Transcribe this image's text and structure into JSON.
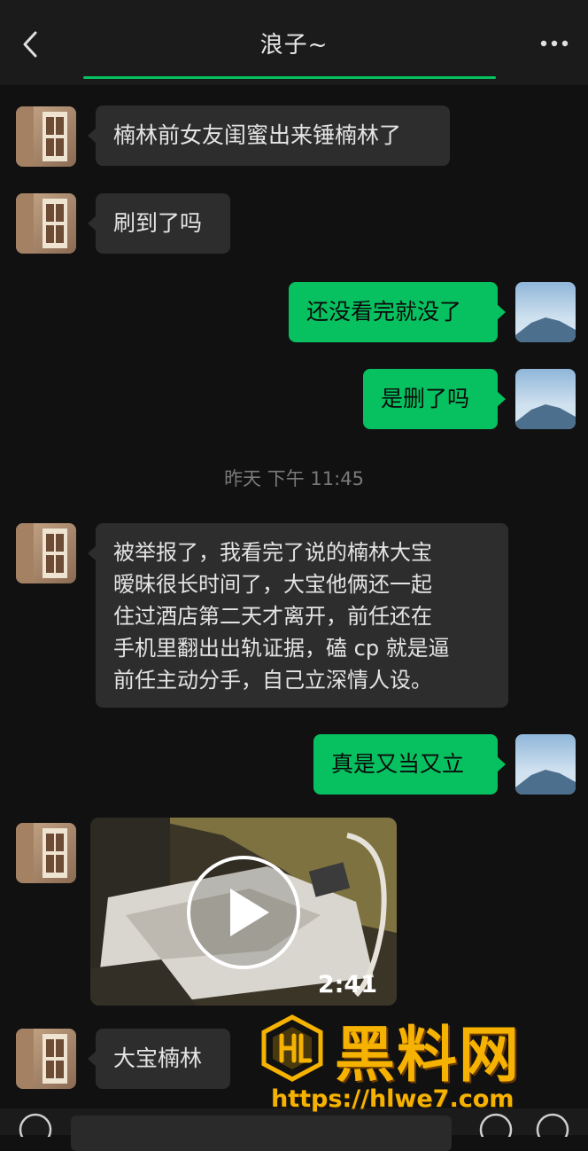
{
  "header": {
    "title": "浪子~"
  },
  "messages": [
    {
      "side": "left",
      "type": "text",
      "text": "楠林前女友闺蜜出来锤楠林了"
    },
    {
      "side": "left",
      "type": "text",
      "text": "刷到了吗"
    },
    {
      "side": "right",
      "type": "text",
      "text": "还没看完就没了"
    },
    {
      "side": "right",
      "type": "text",
      "text": "是删了吗"
    },
    {
      "type": "timestamp",
      "text": "昨天 下午 11:45"
    },
    {
      "side": "left",
      "type": "text",
      "lines": [
        "被举报了，我看完了说的楠林大宝",
        "暧昧很长时间了，大宝他俩还一起",
        "住过酒店第二天才离开，前任还在",
        "手机里翻出出轨证据，磕 cp 就是逼",
        "前任主动分手，自己立深情人设。"
      ]
    },
    {
      "side": "right",
      "type": "text",
      "text": "真是又当又立"
    },
    {
      "side": "left",
      "type": "video",
      "duration": "2:41"
    },
    {
      "side": "left",
      "type": "text",
      "text": "大宝楠林"
    }
  ],
  "watermark": {
    "brand": "黑料网",
    "url": "https://hlwe7.com"
  },
  "colors": {
    "accent": "#07c160",
    "incoming_bubble": "#2d2d2d",
    "background": "#111111",
    "watermark": "#f5b200"
  },
  "icons": {
    "back": "chevron-left-icon",
    "more": "more-dots-icon",
    "play": "play-icon"
  }
}
